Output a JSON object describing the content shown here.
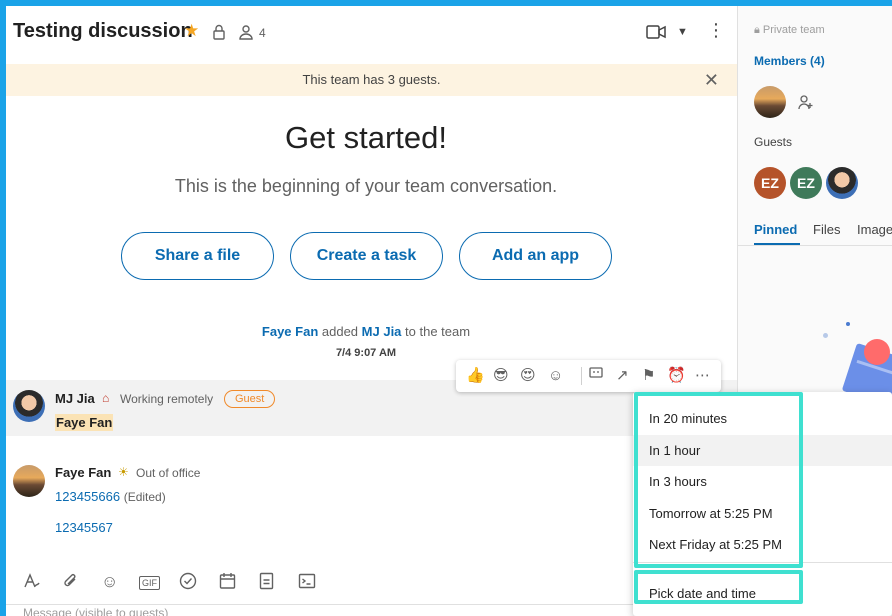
{
  "header": {
    "title": "Testing discussion",
    "member_count": "4"
  },
  "banner": {
    "text": "This team has 3 guests."
  },
  "intro": {
    "heading": "Get started!",
    "subtitle": "This is the beginning of your team conversation.",
    "buttons": [
      "Share a file",
      "Create a task",
      "Add an app"
    ]
  },
  "system_message": {
    "actor": "Faye Fan",
    "verb": "added",
    "target": "MJ Jia",
    "suffix": "to the team",
    "time": "7/4 9:07 AM"
  },
  "posts": [
    {
      "author": "MJ Jia",
      "status": "Working remotely",
      "tag": "Guest",
      "mention": "Faye Fan"
    },
    {
      "author": "Faye Fan",
      "status": "Out of office",
      "lines": [
        "123455666",
        "12345567"
      ],
      "edited": "(Edited)"
    }
  ],
  "compose": {
    "placeholder": "Message (visible to guests)"
  },
  "right_panel": {
    "private_label": "Private team",
    "members_label": "Members (4)",
    "guests_label": "Guests",
    "guest_initials": [
      "EZ",
      "EZ"
    ],
    "tabs": [
      "Pinned",
      "Files",
      "Image"
    ]
  },
  "reminder_menu": {
    "items": [
      "In 20 minutes",
      "In 1 hour",
      "In 3 hours",
      "Tomorrow at 5:25 PM",
      "Next Friday at 5:25 PM"
    ],
    "custom": "Pick date and time"
  },
  "colors": {
    "accent": "#0b6bb1",
    "guest_tag": "#f08a2b",
    "highlight": "#3fe0d0",
    "ez_brown": "#b5532a",
    "ez_green": "#3f7a5a"
  }
}
